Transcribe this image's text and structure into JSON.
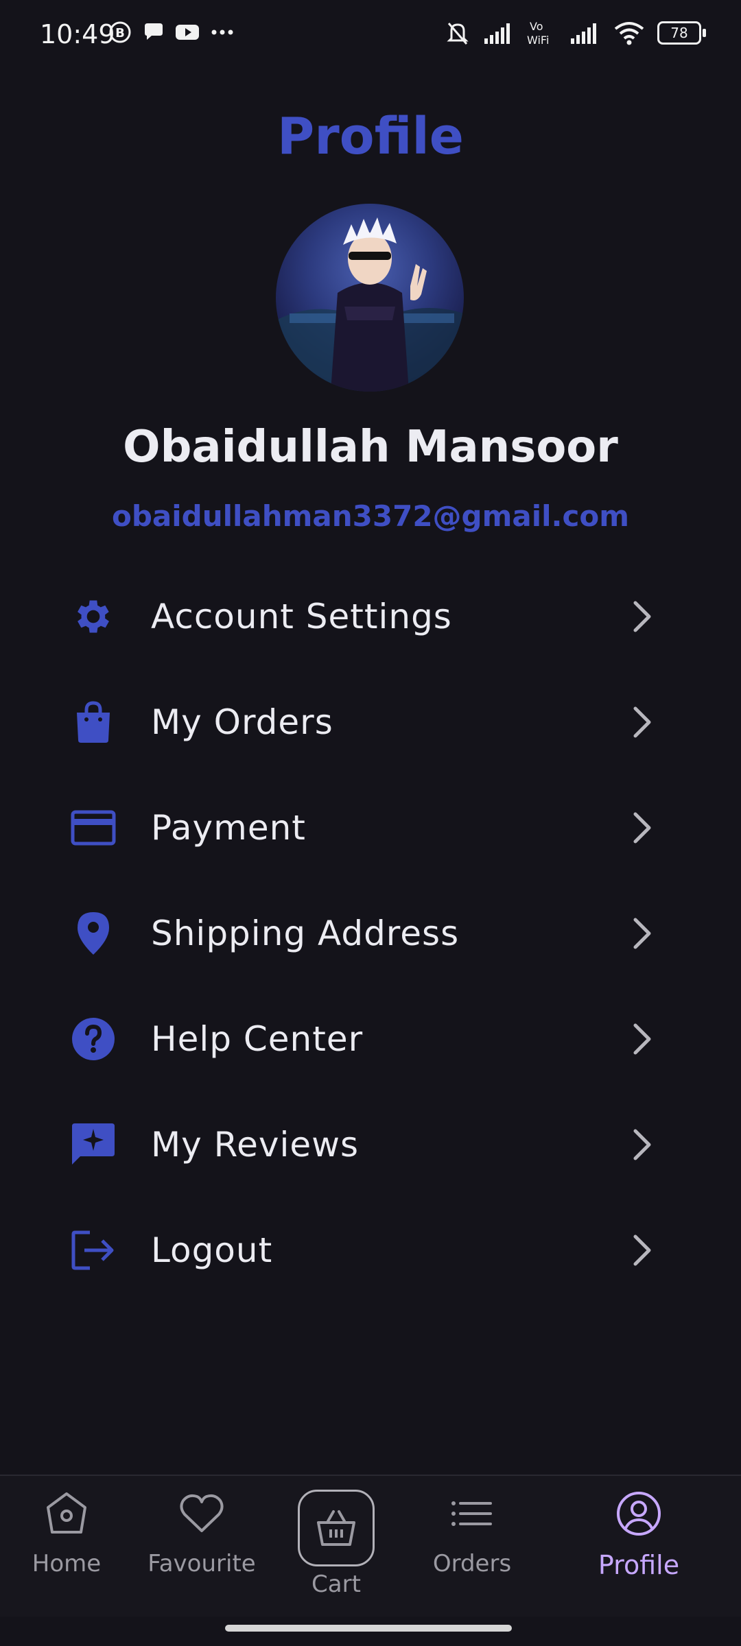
{
  "status_bar": {
    "time": "10:49",
    "left_icons": [
      "b-circle-icon",
      "chat-bubble-icon",
      "youtube-icon",
      "more-dots-icon"
    ],
    "right_icons": [
      "bell-off-icon",
      "signal-icon",
      "vowifi-icon",
      "signal-icon",
      "wifi-icon"
    ],
    "vowifi_text": "Vo\nWiFi",
    "battery": "78"
  },
  "header": {
    "title": "Profile"
  },
  "profile": {
    "name": "Obaidullah Mansoor",
    "email": "obaidullahman3372@gmail.com",
    "avatar_icon": "anime-character-avatar"
  },
  "menu": {
    "items": [
      {
        "label": "Account Settings",
        "icon": "gear-icon"
      },
      {
        "label": "My Orders",
        "icon": "shopping-bag-icon"
      },
      {
        "label": "Payment",
        "icon": "credit-card-icon"
      },
      {
        "label": "Shipping Address",
        "icon": "location-pin-icon"
      },
      {
        "label": "Help Center",
        "icon": "help-circle-icon"
      },
      {
        "label": "My Reviews",
        "icon": "review-star-icon"
      },
      {
        "label": "Logout",
        "icon": "logout-icon"
      }
    ]
  },
  "bottom_nav": {
    "items": [
      {
        "label": "Home",
        "icon": "home-icon"
      },
      {
        "label": "Favourite",
        "icon": "heart-icon"
      },
      {
        "label": "Cart",
        "icon": "basket-icon"
      },
      {
        "label": "Orders",
        "icon": "list-icon"
      },
      {
        "label": "Profile",
        "icon": "user-circle-icon",
        "active": true
      }
    ]
  },
  "colors": {
    "background": "#14131a",
    "accent": "#3f4fc4",
    "active_nav": "#c7a8ff",
    "text": "#ececf2",
    "muted": "#9b9aa2"
  }
}
